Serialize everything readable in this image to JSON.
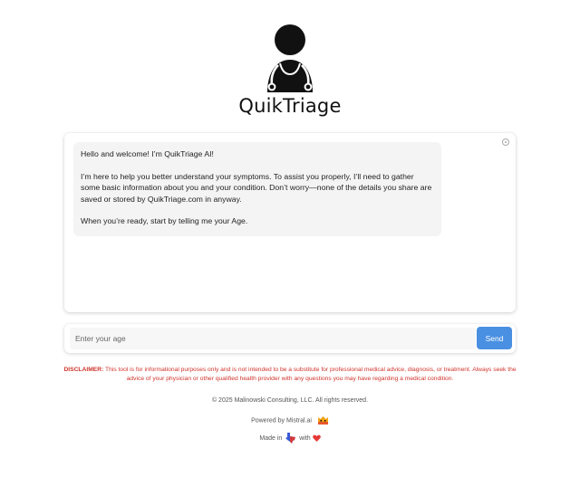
{
  "brand": {
    "name": "QuikTriage"
  },
  "chat": {
    "messages": [
      {
        "role": "assistant",
        "paragraphs": [
          "Hello and welcome! I’m QuikTriage AI!",
          "I’m here to help you better understand your symptoms. To assist you properly, I’ll need to gather some basic information about you and your condition. Don’t worry—none of the details you share are saved or stored by QuikTriage.com in anyway.",
          "When you’re ready, start by telling me your Age."
        ]
      }
    ]
  },
  "input": {
    "placeholder": "Enter your age",
    "value": "",
    "send_label": "Send"
  },
  "disclaimer": {
    "label": "DISCLAIMER:",
    "text": " This tool is for informational purposes only and is not intended to be a substitute for professional medical advice, diagnosis, or treatment. Always seek the advice of your physician or other qualified health provider with any questions you may have regarding a medical condition."
  },
  "footer": {
    "copyright": "© 2025 Malinowski Consulting, LLC. All rights reserved.",
    "powered_by": "Powered by Mistral.ai",
    "made_in_prefix": "Made in",
    "made_in_with": "with"
  },
  "colors": {
    "accent": "#4a90e2",
    "disclaimer": "#d0342c",
    "heart": "#e53935",
    "texas": "#3a5bd9"
  },
  "icons": {
    "logo": "doctor-stethoscope-icon",
    "card_corner": "info-icon",
    "mistral": "mistral-cat-icon",
    "texas": "texas-flag-icon",
    "heart": "heart-icon"
  }
}
